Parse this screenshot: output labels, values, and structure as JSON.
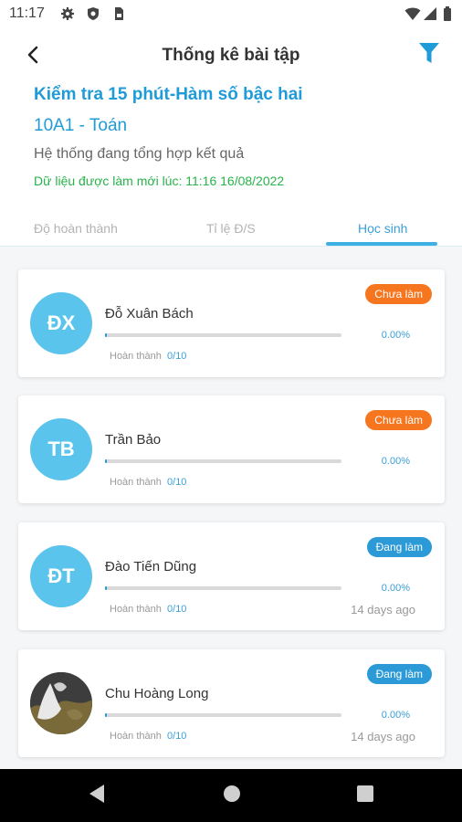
{
  "status_bar": {
    "time": "11:17",
    "icons": [
      "gear-icon",
      "shield-icon",
      "sim-card-icon",
      "wifi-icon",
      "signal-icon",
      "battery-icon"
    ]
  },
  "header": {
    "title": "Thống kê bài tập",
    "back_icon": "chevron-left-icon",
    "filter_icon": "filter-icon"
  },
  "info": {
    "exam_title": "Kiểm tra 15 phút-Hàm số bậc hai",
    "class_name": "10A1 - Toán",
    "system_text": "Hệ thống đang tổng hợp kết quả",
    "updated_text": "Dữ liệu được làm mới lúc: 11:16 16/08/2022"
  },
  "tabs": [
    {
      "label": "Độ hoàn thành",
      "active": false
    },
    {
      "label": "Tỉ lệ Đ/S",
      "active": false
    },
    {
      "label": "Học sinh",
      "active": true
    }
  ],
  "students": [
    {
      "initials": "ĐX",
      "name": "Đỗ Xuân Bách",
      "status": "Chưa làm",
      "percent": "0.00%",
      "progress": 0.0,
      "done_label": "Hoàn thành",
      "done_count": "0/10",
      "days_ago": ""
    },
    {
      "initials": "TB",
      "name": "Trần Bảo",
      "status": "Chưa làm",
      "percent": "0.00%",
      "progress": 0.0,
      "done_label": "Hoàn thành",
      "done_count": "0/10",
      "days_ago": ""
    },
    {
      "initials": "ĐT",
      "name": "Đào Tiến Dũng",
      "status": "Đang làm",
      "percent": "0.00%",
      "progress": 0.0,
      "done_label": "Hoàn thành",
      "done_count": "0/10",
      "days_ago": "14 days ago"
    },
    {
      "initials": "",
      "name": "Chu Hoàng Long",
      "status": "Đang làm",
      "percent": "0.00%",
      "progress": 0.0,
      "done_label": "Hoàn thành",
      "done_count": "0/10",
      "days_ago": "14 days ago"
    }
  ],
  "colors": {
    "accent": "#1f9bd8",
    "avatar": "#5bc4ec",
    "not_started": "#f5761f",
    "in_progress": "#2b9ad6",
    "updated_green": "#27b34a"
  },
  "nav_bar": {
    "icons": [
      "back-triangle-icon",
      "home-circle-icon",
      "recents-square-icon"
    ]
  }
}
